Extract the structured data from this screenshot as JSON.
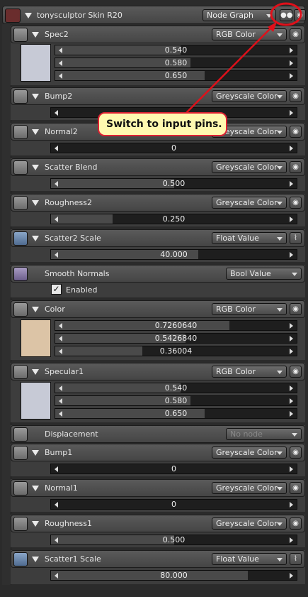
{
  "header": {
    "title": "tonysculptor Skin R20",
    "mode": "Node Graph"
  },
  "callout": {
    "text": "Switch to input pins."
  },
  "sections": {
    "spec2": {
      "label": "Spec2",
      "type": "RGB Color",
      "swatch": "#c7cad6",
      "values": [
        "0.540",
        "0.580",
        "0.650"
      ]
    },
    "bump2": {
      "label": "Bump2",
      "type": "Greyscale Color"
    },
    "normal2": {
      "label": "Normal2",
      "type": "Greyscale Color",
      "value": "0"
    },
    "scatter_blend": {
      "label": "Scatter Blend",
      "type": "Greyscale Color",
      "value": "0.500"
    },
    "roughness2": {
      "label": "Roughness2",
      "type": "Greyscale Color",
      "value": "0.250"
    },
    "scatter2_scale": {
      "label": "Scatter2 Scale",
      "type": "Float Value",
      "value": "40.000"
    },
    "smooth_normals": {
      "label": "Smooth Normals",
      "type": "Bool Value",
      "checkbox": "Enabled"
    },
    "color": {
      "label": "Color",
      "type": "RGB Color",
      "swatch": "#dcc4a6",
      "values": [
        "0.7260640",
        "0.5426840",
        "0.36004"
      ]
    },
    "specular1": {
      "label": "Specular1",
      "type": "RGB Color",
      "swatch": "#c7cad6",
      "values": [
        "0.540",
        "0.580",
        "0.650"
      ]
    },
    "displacement": {
      "label": "Displacement",
      "type": "No node"
    },
    "bump1": {
      "label": "Bump1",
      "type": "Greyscale Color",
      "value": "0"
    },
    "normal1": {
      "label": "Normal1",
      "type": "Greyscale Color",
      "value": "0"
    },
    "roughness1": {
      "label": "Roughness1",
      "type": "Greyscale Color",
      "value": "0.500"
    },
    "scatter1_scale": {
      "label": "Scatter1 Scale",
      "type": "Float Value",
      "value": "80.000"
    }
  },
  "colors": {
    "highlight": "#e0101a",
    "panel": "#3d3d3d"
  },
  "icons": {
    "pins": "input-pins-icon",
    "eye": "eye-icon"
  }
}
